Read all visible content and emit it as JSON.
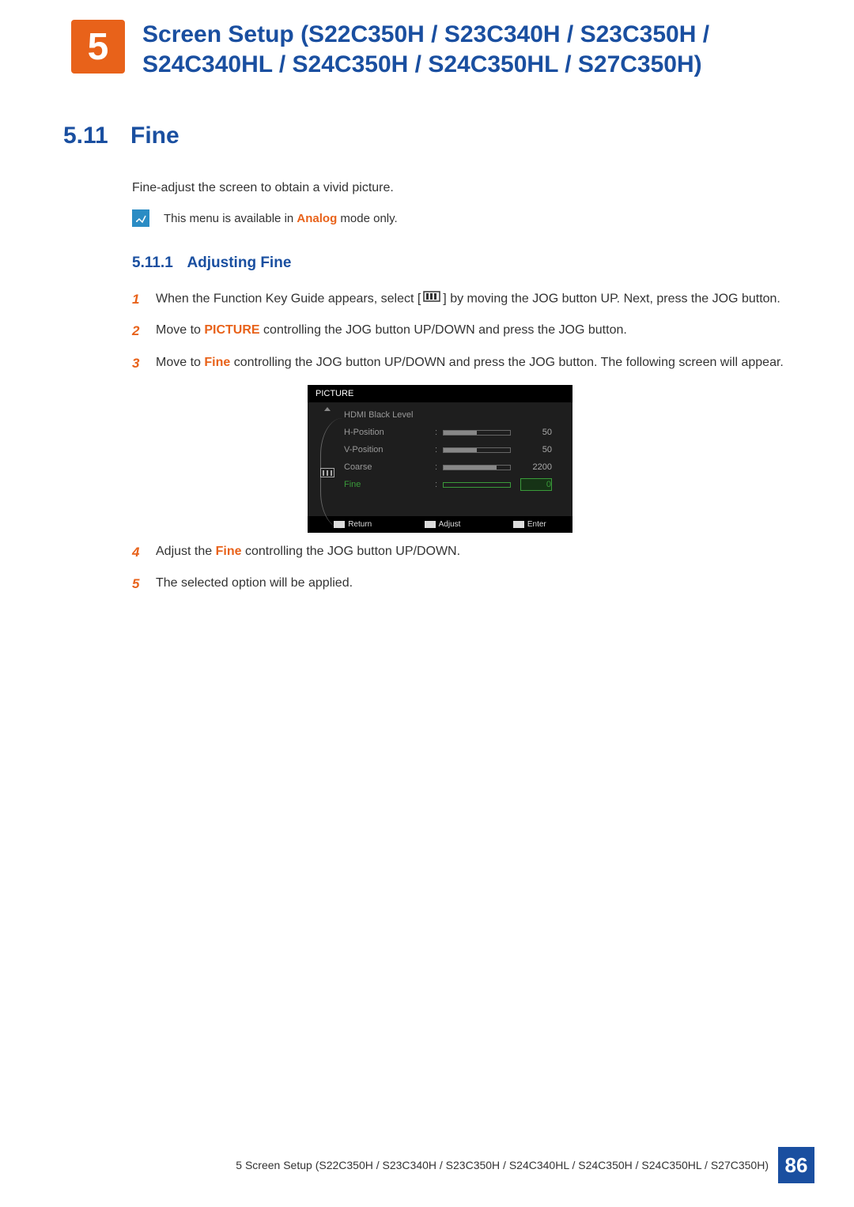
{
  "header": {
    "chapter_num": "5",
    "title": "Screen Setup (S22C350H / S23C340H / S23C350H / S24C340HL / S24C350H / S24C350HL / S27C350H)"
  },
  "section": {
    "num": "5.11",
    "title": "Fine",
    "intro": "Fine-adjust the screen to obtain a vivid picture.",
    "note_prefix": "This menu is available in ",
    "note_mode": "Analog",
    "note_suffix": " mode only."
  },
  "subsection": {
    "num": "5.11.1",
    "title": "Adjusting Fine"
  },
  "steps": {
    "s1_a": "When the Function Key Guide appears, select [",
    "s1_b": "] by moving the JOG button UP. Next, press the JOG button.",
    "s2_a": "Move to ",
    "s2_word": "PICTURE",
    "s2_b": " controlling the JOG button UP/DOWN and press the JOG button.",
    "s3_a": "Move to ",
    "s3_word": "Fine",
    "s3_b": " controlling the JOG button UP/DOWN and press the JOG button. The following screen will appear.",
    "s4_a": "Adjust the ",
    "s4_word": "Fine",
    "s4_b": " controlling the JOG button UP/DOWN.",
    "s5": "The selected option will be applied.",
    "n1": "1",
    "n2": "2",
    "n3": "3",
    "n4": "4",
    "n5": "5"
  },
  "osd": {
    "title": "PICTURE",
    "rows": [
      {
        "label": "HDMI Black Level",
        "val": "",
        "bar": null
      },
      {
        "label": "H-Position",
        "val": "50",
        "bar": 50
      },
      {
        "label": "V-Position",
        "val": "50",
        "bar": 50
      },
      {
        "label": "Coarse",
        "val": "2200",
        "bar": 80
      },
      {
        "label": "Fine",
        "val": "0",
        "bar": 0,
        "sel": true
      }
    ],
    "foot": {
      "return": "Return",
      "adjust": "Adjust",
      "enter": "Enter"
    }
  },
  "footer": {
    "text": "5 Screen Setup (S22C350H / S23C340H / S23C350H / S24C340HL / S24C350H / S24C350HL / S27C350H)",
    "page": "86"
  }
}
